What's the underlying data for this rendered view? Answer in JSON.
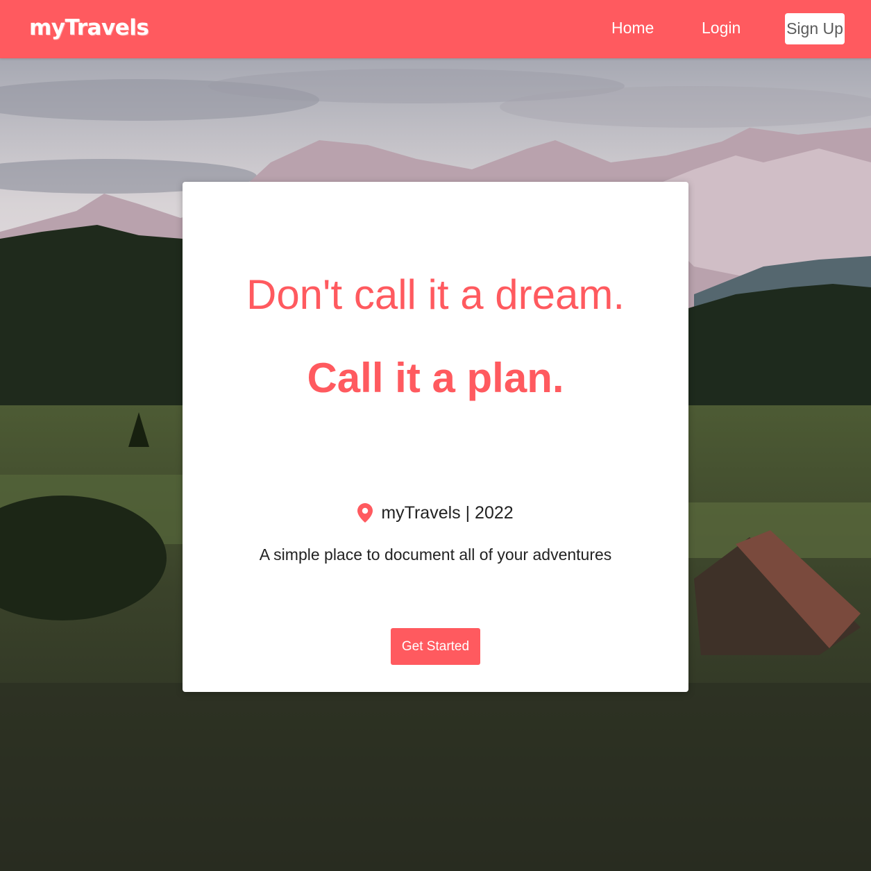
{
  "header": {
    "brand": "myTravels",
    "nav": {
      "home_label": "Home",
      "login_label": "Login",
      "signup_label": "Sign Up"
    }
  },
  "hero": {
    "headline_1": "Don't call it a dream.",
    "headline_2": "Call it a plan.",
    "meta_text": "myTravels | 2022",
    "meta_icon": "map-pin-icon",
    "tagline": "A simple place to document all of your adventures",
    "cta_label": "Get Started"
  },
  "colors": {
    "accent": "#ff5a5f",
    "card_bg": "#ffffff",
    "text_dark": "#222222"
  }
}
